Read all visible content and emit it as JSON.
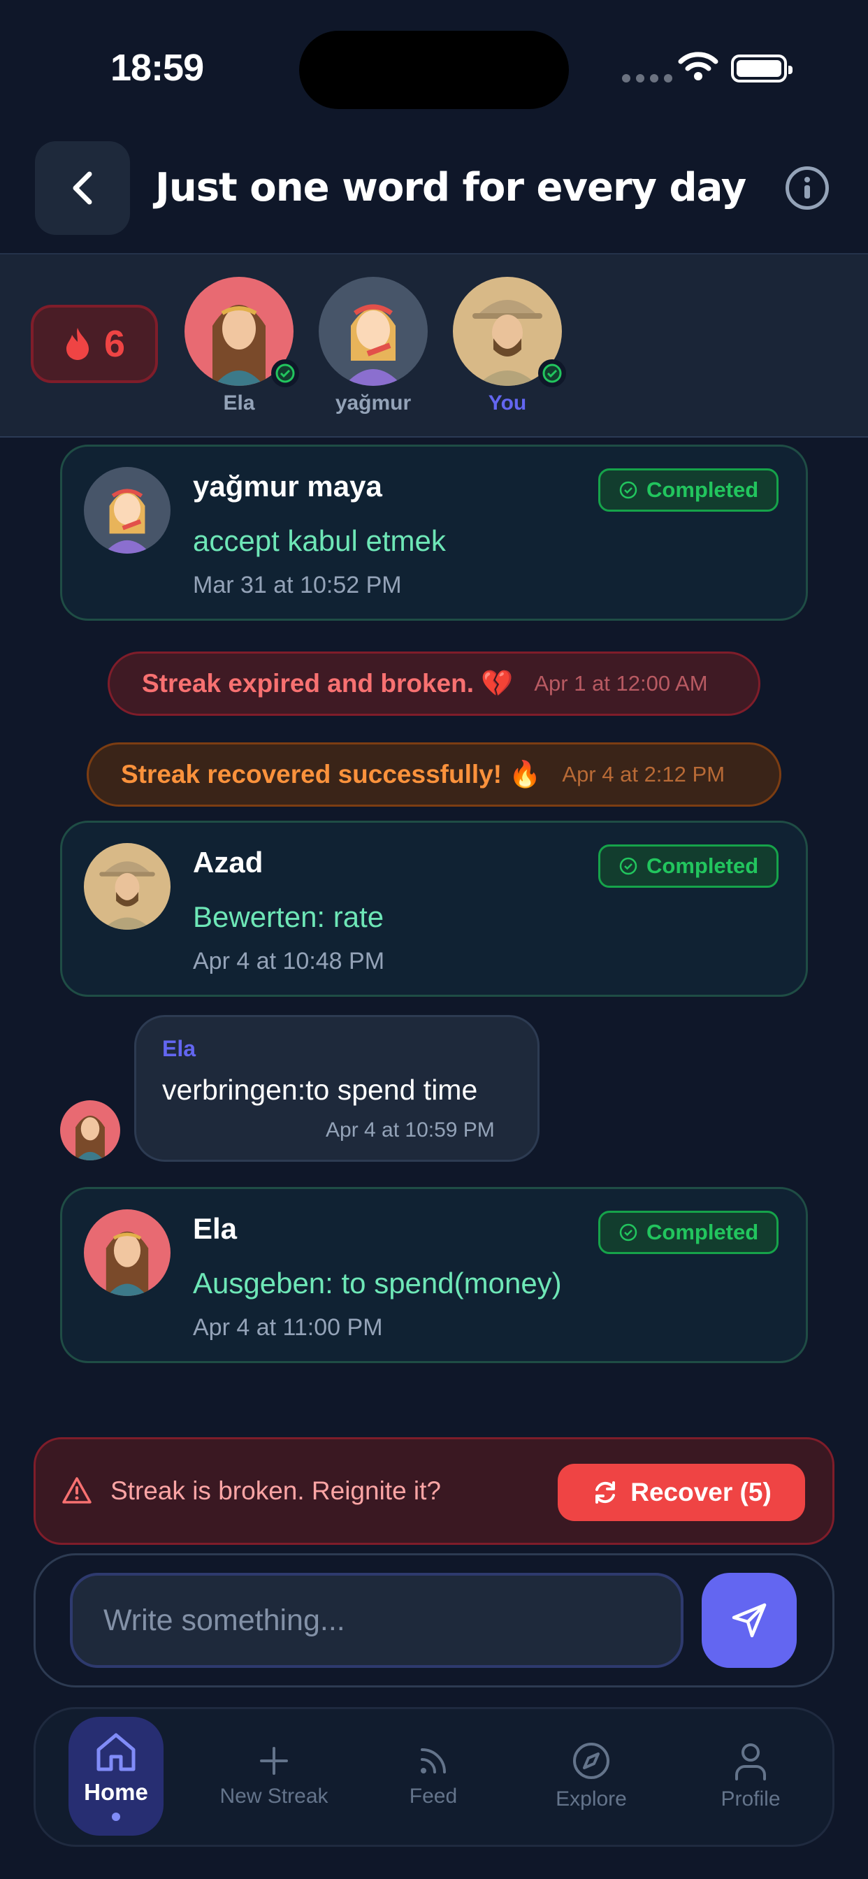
{
  "status_bar": {
    "time": "18:59"
  },
  "header": {
    "title": "Just one word for every day"
  },
  "streak": {
    "count": "6"
  },
  "members": [
    {
      "name": "Ela",
      "completed": true,
      "is_you": false
    },
    {
      "name": "yağmur",
      "completed": false,
      "is_you": false
    },
    {
      "name": "You",
      "completed": true,
      "is_you": true
    }
  ],
  "feed": {
    "card1": {
      "name": "yağmur maya",
      "word": "accept kabul etmek",
      "time": "Mar 31 at 10:52 PM",
      "status": "Completed"
    },
    "system1": {
      "text": "Streak expired and broken. 💔",
      "time": "Apr 1 at 12:00 AM"
    },
    "system2": {
      "text": "Streak recovered successfully! 🔥",
      "time": "Apr 4 at 2:12 PM"
    },
    "card2": {
      "name": "Azad",
      "word": "Bewerten: rate",
      "time": "Apr 4 at 10:48 PM",
      "status": "Completed"
    },
    "bubble": {
      "sender": "Ela",
      "text": "verbringen:to spend time",
      "time": "Apr 4 at 10:59 PM"
    },
    "card3": {
      "name": "Ela",
      "word": "Ausgeben: to spend(money)",
      "time": "Apr 4 at 11:00 PM",
      "status": "Completed"
    }
  },
  "recover": {
    "message": "Streak is broken. Reignite it?",
    "button": "Recover (5)"
  },
  "composer": {
    "placeholder": "Write something..."
  },
  "tabs": [
    {
      "label": "Home",
      "icon": "home-icon",
      "active": true
    },
    {
      "label": "New Streak",
      "icon": "plus-icon",
      "active": false
    },
    {
      "label": "Feed",
      "icon": "rss-icon",
      "active": false
    },
    {
      "label": "Explore",
      "icon": "compass-icon",
      "active": false
    },
    {
      "label": "Profile",
      "icon": "user-icon",
      "active": false
    }
  ],
  "colors": {
    "accent": "#6366f1",
    "completed": "#22c55e",
    "danger": "#ef4444",
    "warning": "#fb923c",
    "background": "#0f1729"
  }
}
